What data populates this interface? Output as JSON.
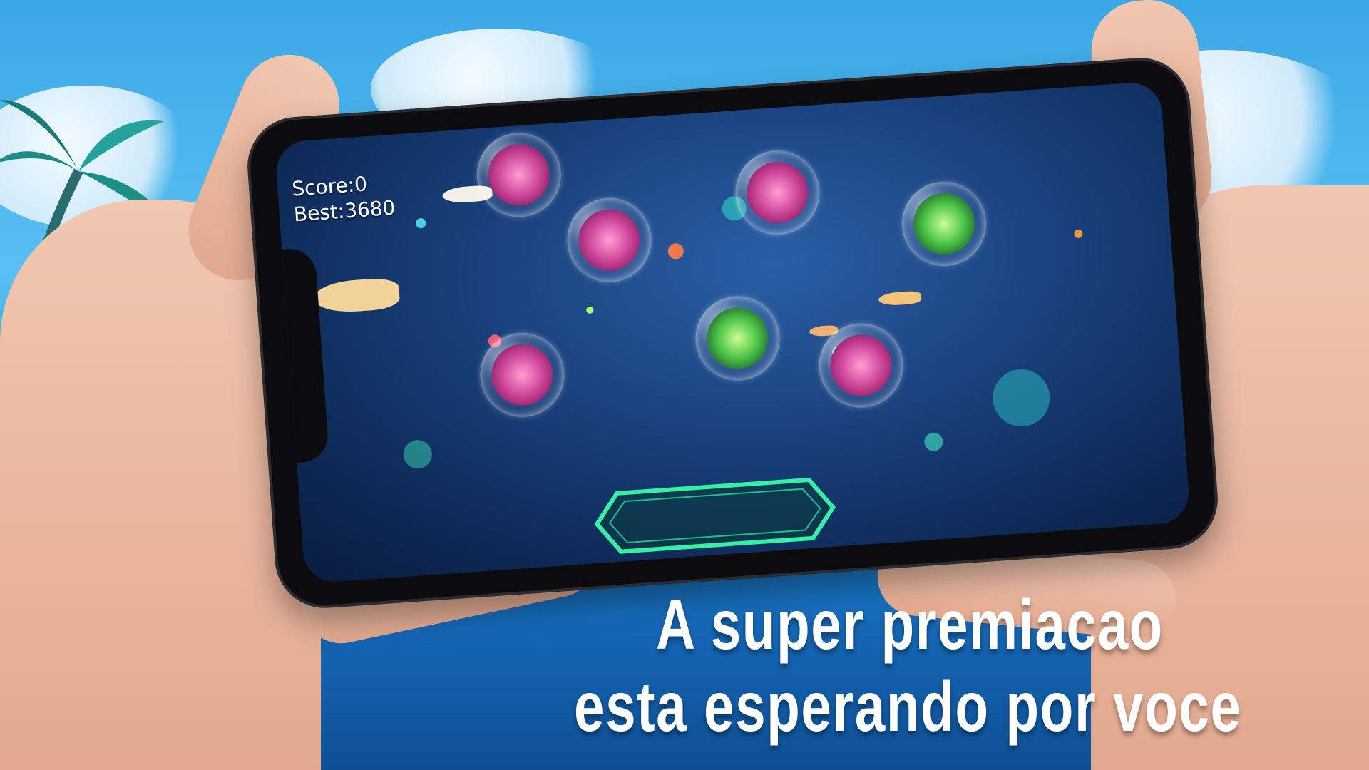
{
  "game": {
    "score_label": "Score:0",
    "best_label": "Best:3680"
  },
  "promo": {
    "line1": "A super premiacao",
    "line2": "esta esperando por voce"
  },
  "colors": {
    "sky": "#59c0f2",
    "sea": "#1566b5",
    "pink_urchin": "#c0408f",
    "green_urchin": "#3fbf4a",
    "paddle_glow": "#36f0a6"
  },
  "bubbles": [
    {
      "variant": "pink"
    },
    {
      "variant": "pink"
    },
    {
      "variant": "pink"
    },
    {
      "variant": "green"
    },
    {
      "variant": "green"
    },
    {
      "variant": "pink"
    },
    {
      "variant": "pink"
    }
  ]
}
